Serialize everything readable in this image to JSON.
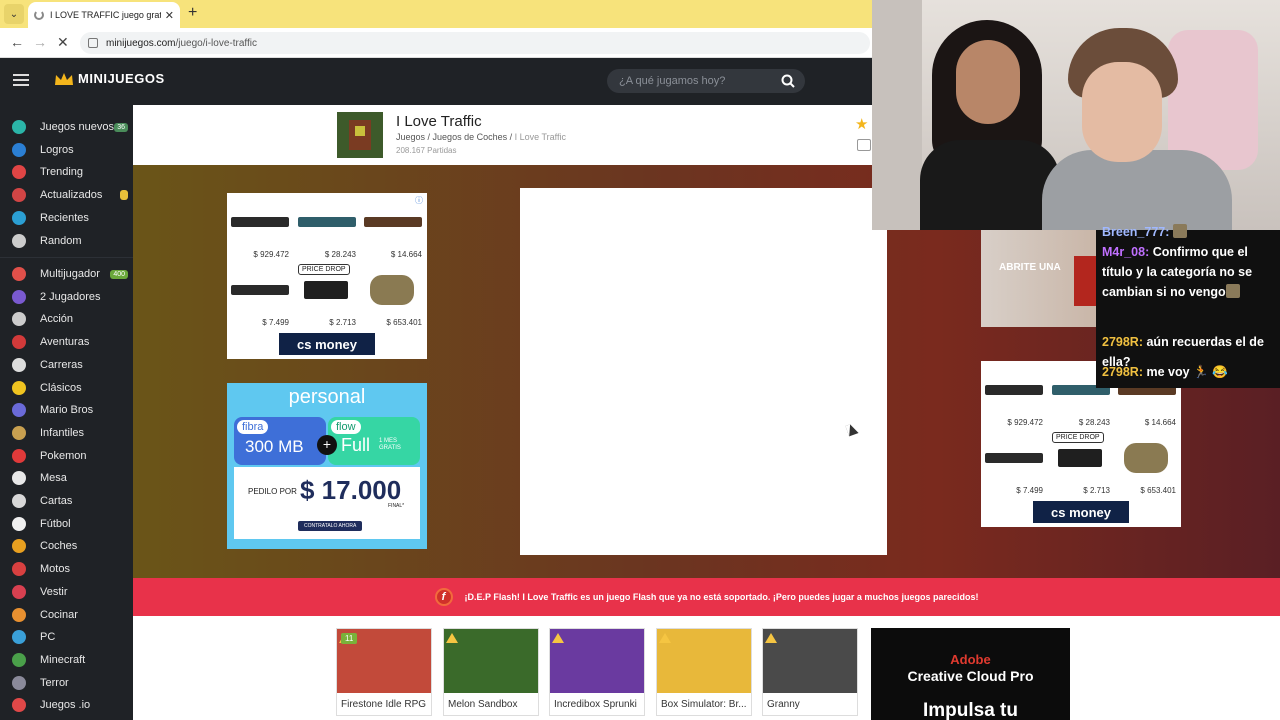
{
  "browser": {
    "tab_title": "I LOVE TRAFFIC juego gratis onli",
    "new_tab": "+",
    "url_host": "minijuegos.com",
    "url_path": "/juego/i-love-traffic"
  },
  "site": {
    "logo": "MINIJUEGOS",
    "search_placeholder": "¿A qué jugamos hoy?"
  },
  "sidebar": {
    "top_items": [
      {
        "label": "Juegos nuevos",
        "badge": "36",
        "color": "#2bb5a8",
        "badge_color": "#4a8c5a"
      },
      {
        "label": "Logros",
        "color": "#2b7fd3"
      },
      {
        "label": "Trending",
        "color": "#e04545"
      },
      {
        "label": "Actualizados",
        "badge": "",
        "color": "#d24545",
        "badge_color": "#e8c13a"
      },
      {
        "label": "Recientes",
        "color": "#2b9fd3"
      },
      {
        "label": "Random",
        "color": "#cccccc"
      }
    ],
    "categories": [
      {
        "label": "Multijugador",
        "badge": "400",
        "color": "#e0504a",
        "badge_color": "#6aa83a"
      },
      {
        "label": "2 Jugadores",
        "color": "#7a5ad0"
      },
      {
        "label": "Acción",
        "color": "#cccccc"
      },
      {
        "label": "Aventuras",
        "color": "#d23a3a"
      },
      {
        "label": "Carreras",
        "color": "#dddddd"
      },
      {
        "label": "Clásicos",
        "color": "#f0c420"
      },
      {
        "label": "Mario Bros",
        "color": "#6a6ad8"
      },
      {
        "label": "Infantiles",
        "color": "#c8a050"
      },
      {
        "label": "Pokemon",
        "color": "#e03a3a"
      },
      {
        "label": "Mesa",
        "color": "#e8e8e8"
      },
      {
        "label": "Cartas",
        "color": "#d8d8d8"
      },
      {
        "label": "Fútbol",
        "color": "#f0f0f0"
      },
      {
        "label": "Coches",
        "color": "#e8a020"
      },
      {
        "label": "Motos",
        "color": "#d84040"
      },
      {
        "label": "Vestir",
        "color": "#d84050"
      },
      {
        "label": "Cocinar",
        "color": "#e89030"
      },
      {
        "label": "PC",
        "color": "#3aa0d8"
      },
      {
        "label": "Minecraft",
        "color": "#4aa04a"
      },
      {
        "label": "Terror",
        "color": "#8a8a9a"
      },
      {
        "label": "Juegos .io",
        "color": "#e04848"
      }
    ]
  },
  "game": {
    "title": "I Love Traffic",
    "crumb_1": "Juegos",
    "crumb_2": "Juegos de Coches",
    "crumb_3": "I Love Traffic",
    "plays": "208.167 Partidas"
  },
  "ads": {
    "cs_prices": [
      "$ 929.472",
      "$ 28.243",
      "$ 14.664",
      "$ 7.499",
      "$ 2.713",
      "$ 653.401"
    ],
    "cs_tag": "PRICE DROP",
    "cs_brand": "cs money",
    "personal": {
      "brand": "personal",
      "fibra": "fibra",
      "mb": "300 MB",
      "flow": "flow",
      "full": "Full",
      "mes": "1 MES GRATIS",
      "pedilo": "PEDILO POR",
      "amount": "$ 17.000",
      "final": "FINAL*",
      "cta": "CONTRATALO AHORA"
    },
    "adobe": {
      "line1": "Adobe",
      "line2": "Creative Cloud Pro",
      "line3": "Impulsa tu"
    }
  },
  "flash_notice": "¡D.E.P Flash! I Love Traffic es un juego Flash que ya no está soportado. ¡Pero puedes jugar a muchos juegos parecidos!",
  "related_games": [
    {
      "name": "Firestone Idle RPG",
      "count": "11",
      "color": "#c24a3a"
    },
    {
      "name": "Melon Sandbox",
      "color": "#3a6a2a"
    },
    {
      "name": "Incredibox Sprunki",
      "color": "#6a3aa0"
    },
    {
      "name": "Box Simulator: Br...",
      "color": "#e8b83a"
    },
    {
      "name": "Granny",
      "color": "#4a4a4a"
    }
  ],
  "stream": {
    "video_text": "ABRITE UNA",
    "chat": [
      {
        "user": "Breen_777:",
        "user_color": "#a0b8ff",
        "text": ""
      },
      {
        "user": "M4r_08:",
        "user_color": "#c070ff",
        "text": "Confirmo que el título y la categoría no se cambian si no vengo"
      },
      {
        "user": "2798R:",
        "user_color": "#f0c040",
        "text": "aún recuerdas el de ella?"
      },
      {
        "user": "2798R:",
        "user_color": "#f0c040",
        "text": "me voy 🏃 😂"
      }
    ]
  }
}
